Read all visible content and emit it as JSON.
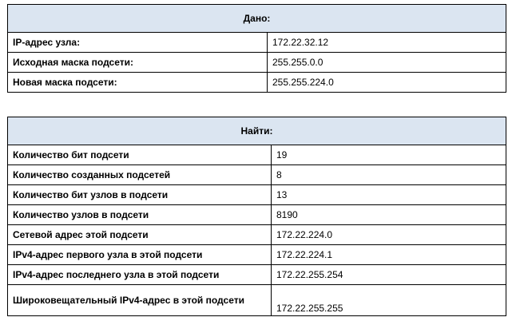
{
  "given": {
    "header": "Дано:",
    "rows": [
      {
        "label": "IP-адрес узла:",
        "value": "172.22.32.12"
      },
      {
        "label": "Исходная маска подсети:",
        "value": "255.255.0.0"
      },
      {
        "label": "Новая маска подсети:",
        "value": "255.255.224.0"
      }
    ]
  },
  "find": {
    "header": "Найти:",
    "rows": [
      {
        "label": "Количество бит подсети",
        "value": "19"
      },
      {
        "label": "Количество созданных подсетей",
        "value": "8"
      },
      {
        "label": "Количество бит узлов в подсети",
        "value": "13"
      },
      {
        "label": "Количество узлов в подсети",
        "value": "8190"
      },
      {
        "label": "Сетевой адрес этой подсети",
        "value": "172.22.224.0"
      },
      {
        "label": "IPv4-адрес первого узла в этой подсети",
        "value": "172.22.224.1"
      },
      {
        "label": "IPv4-адрес последнего узла в этой подсети",
        "value": "172.22.255.254"
      },
      {
        "label": "Широковещательный IPv4-адрес в этой подсети",
        "value": "172.22.255.255"
      }
    ]
  }
}
